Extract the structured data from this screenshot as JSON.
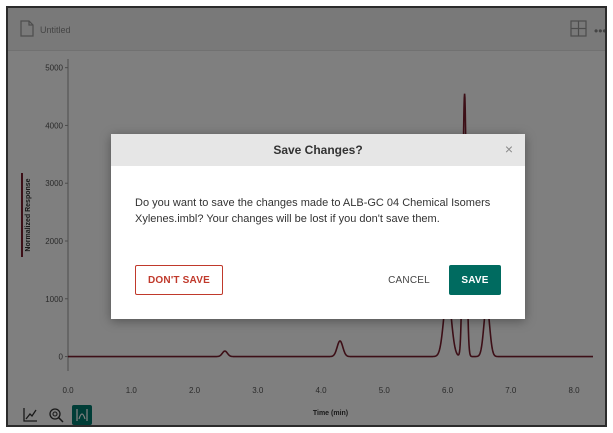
{
  "header": {
    "doc_title": "Untitled",
    "doc_icon": "document-icon",
    "layout_icon": "layout-grid-icon",
    "more_icon": "more-icon"
  },
  "chart_data": {
    "type": "line",
    "xlabel": "Time (min)",
    "ylabel": "Normalized Response",
    "xlim": [
      0,
      8.3
    ],
    "ylim": [
      -250,
      5150
    ],
    "x_ticks": [
      "0.0",
      "1.0",
      "2.0",
      "3.0",
      "4.0",
      "5.0",
      "6.0",
      "7.0",
      "8.0"
    ],
    "y_ticks": [
      "0",
      "1000",
      "2000",
      "3000",
      "4000",
      "5000"
    ],
    "grid": false,
    "line_color": "#7a1f2e",
    "baseline": 0,
    "peaks": [
      {
        "center": 2.48,
        "height": 95,
        "width": 0.04
      },
      {
        "center": 4.3,
        "height": 270,
        "width": 0.045
      },
      {
        "center": 6.0,
        "height": 1100,
        "width": 0.06
      },
      {
        "center": 6.27,
        "height": 4550,
        "width": 0.028
      },
      {
        "center": 6.62,
        "height": 900,
        "width": 0.045
      }
    ]
  },
  "toolbar": {
    "tools": [
      "axis-scale-icon",
      "zoom-icon",
      "peak-select-icon"
    ]
  },
  "dialog": {
    "title": "Save Changes?",
    "close_icon": "close-icon",
    "close_glyph": "×",
    "message": "Do you want to save the changes made to ALB-GC 04 Chemical Isomers Xylenes.imbl? Your changes will be lost if you don't save them.",
    "dont_save_label": "DON'T SAVE",
    "cancel_label": "CANCEL",
    "save_label": "SAVE",
    "accent_color": "#006b60",
    "danger_color": "#c0392b"
  }
}
